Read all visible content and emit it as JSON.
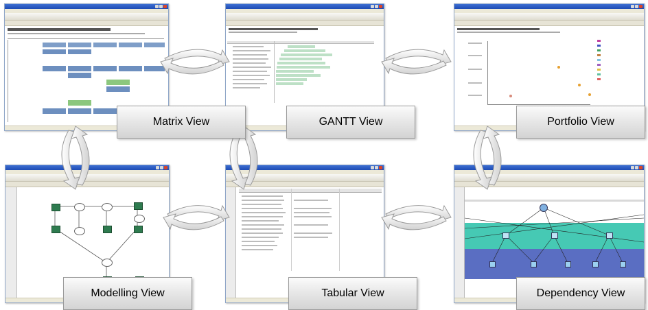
{
  "views": [
    {
      "id": "matrix",
      "label": "Matrix View"
    },
    {
      "id": "gantt",
      "label": "GANTT View"
    },
    {
      "id": "portfolio",
      "label": "Portfolio View"
    },
    {
      "id": "modelling",
      "label": "Modelling View"
    },
    {
      "id": "tabular",
      "label": "Tabular View"
    },
    {
      "id": "dependency",
      "label": "Dependency View"
    }
  ],
  "colors": {
    "window_title": "#2a5bc6",
    "gantt_bar": "#bde0c6",
    "matrix_cell": "#7f9ec8",
    "model_node": "#2e7b4f",
    "dep_band_teal": "#46c9b4",
    "dep_band_blue": "#5a6ec2",
    "arrow_fill": "#e6e6e6"
  },
  "icons": [
    "cycle-arrow-icon"
  ]
}
